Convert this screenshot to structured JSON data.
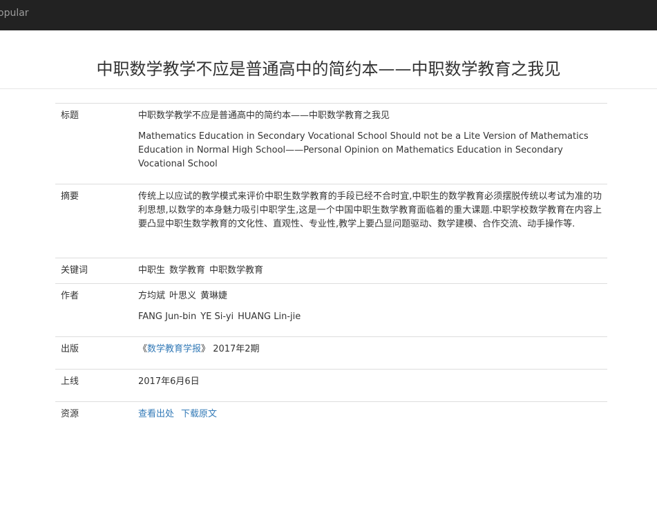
{
  "navbar": {
    "brand": "opular"
  },
  "page_title": "中职数学教学不应是普通高中的简约本——中职数学教育之我见",
  "labels": {
    "title": "标题",
    "abstract": "摘要",
    "keywords": "关键词",
    "authors": "作者",
    "publication": "出版",
    "online": "上线",
    "resources": "资源"
  },
  "article": {
    "title_zh": "中职数学教学不应是普通高中的简约本——中职数学教育之我见",
    "title_en": "Mathematics Education in Secondary Vocational School Should not be a Lite Version of Mathematics Education in Normal High School——Personal Opinion on Mathematics Education in Secondary Vocational School",
    "abstract": "传统上以应试的教学模式来评价中职生数学教育的手段已经不合时宜,中职生的数学教育必须摆脱传统以考试为准的功利思想,以数学的本身魅力吸引中职学生,这是一个中国中职生数学教育面临着的重大课题.中职学校数学教育在内容上要凸显中职生数学教育的文化性、直观性、专业性,教学上要凸显问题驱动、数学建模、合作交流、动手操作等.",
    "keywords": [
      "中职生",
      "数学教育",
      "中职数学教育"
    ],
    "authors_zh": [
      "方均斌",
      "叶思义",
      "黄琳婕"
    ],
    "authors_en": [
      "FANG Jun-bin",
      "YE Si-yi",
      "HUANG Lin-jie"
    ],
    "publication": {
      "open_quote": "《",
      "journal": "数学教育学报",
      "close_quote": "》",
      "issue": "2017年2期"
    },
    "online_date": "2017年6月6日",
    "resources": {
      "view_source": "查看出处",
      "download": "下载原文"
    }
  },
  "colors": {
    "navbar_bg": "#222222",
    "link": "#337ab7",
    "border": "#dddddd"
  }
}
